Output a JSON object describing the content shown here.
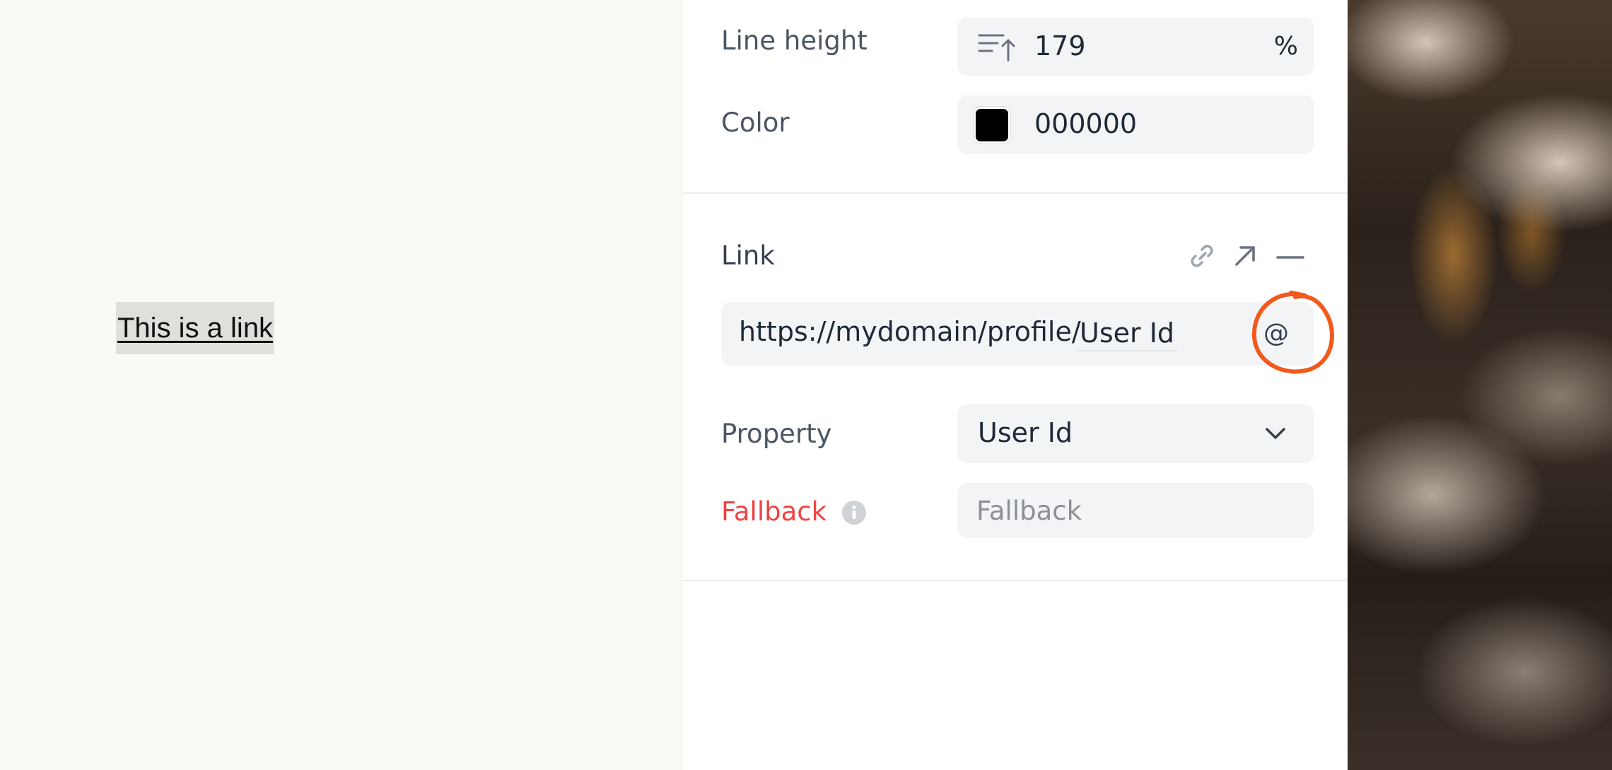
{
  "canvas": {
    "link_text": "This is a link"
  },
  "panel": {
    "line_height": {
      "label": "Line height",
      "icon": "line-height-icon",
      "value": "179",
      "unit": "%"
    },
    "color": {
      "label": "Color",
      "swatch": "#000000",
      "value": "000000"
    },
    "link": {
      "label": "Link",
      "tools": [
        "link-icon",
        "external-arrow-icon",
        "minus-icon"
      ],
      "url_prefix": "https://mydomain/profile/",
      "url_token": "User Id",
      "insert_variable_symbol": "@"
    },
    "property": {
      "label": "Property",
      "selected": "User Id"
    },
    "fallback": {
      "label": "Fallback",
      "placeholder": "Fallback",
      "value": ""
    }
  },
  "colors": {
    "fallback_label": "#ef4444",
    "annotation": "#f25a1d",
    "field_bg": "#f3f4f6"
  }
}
